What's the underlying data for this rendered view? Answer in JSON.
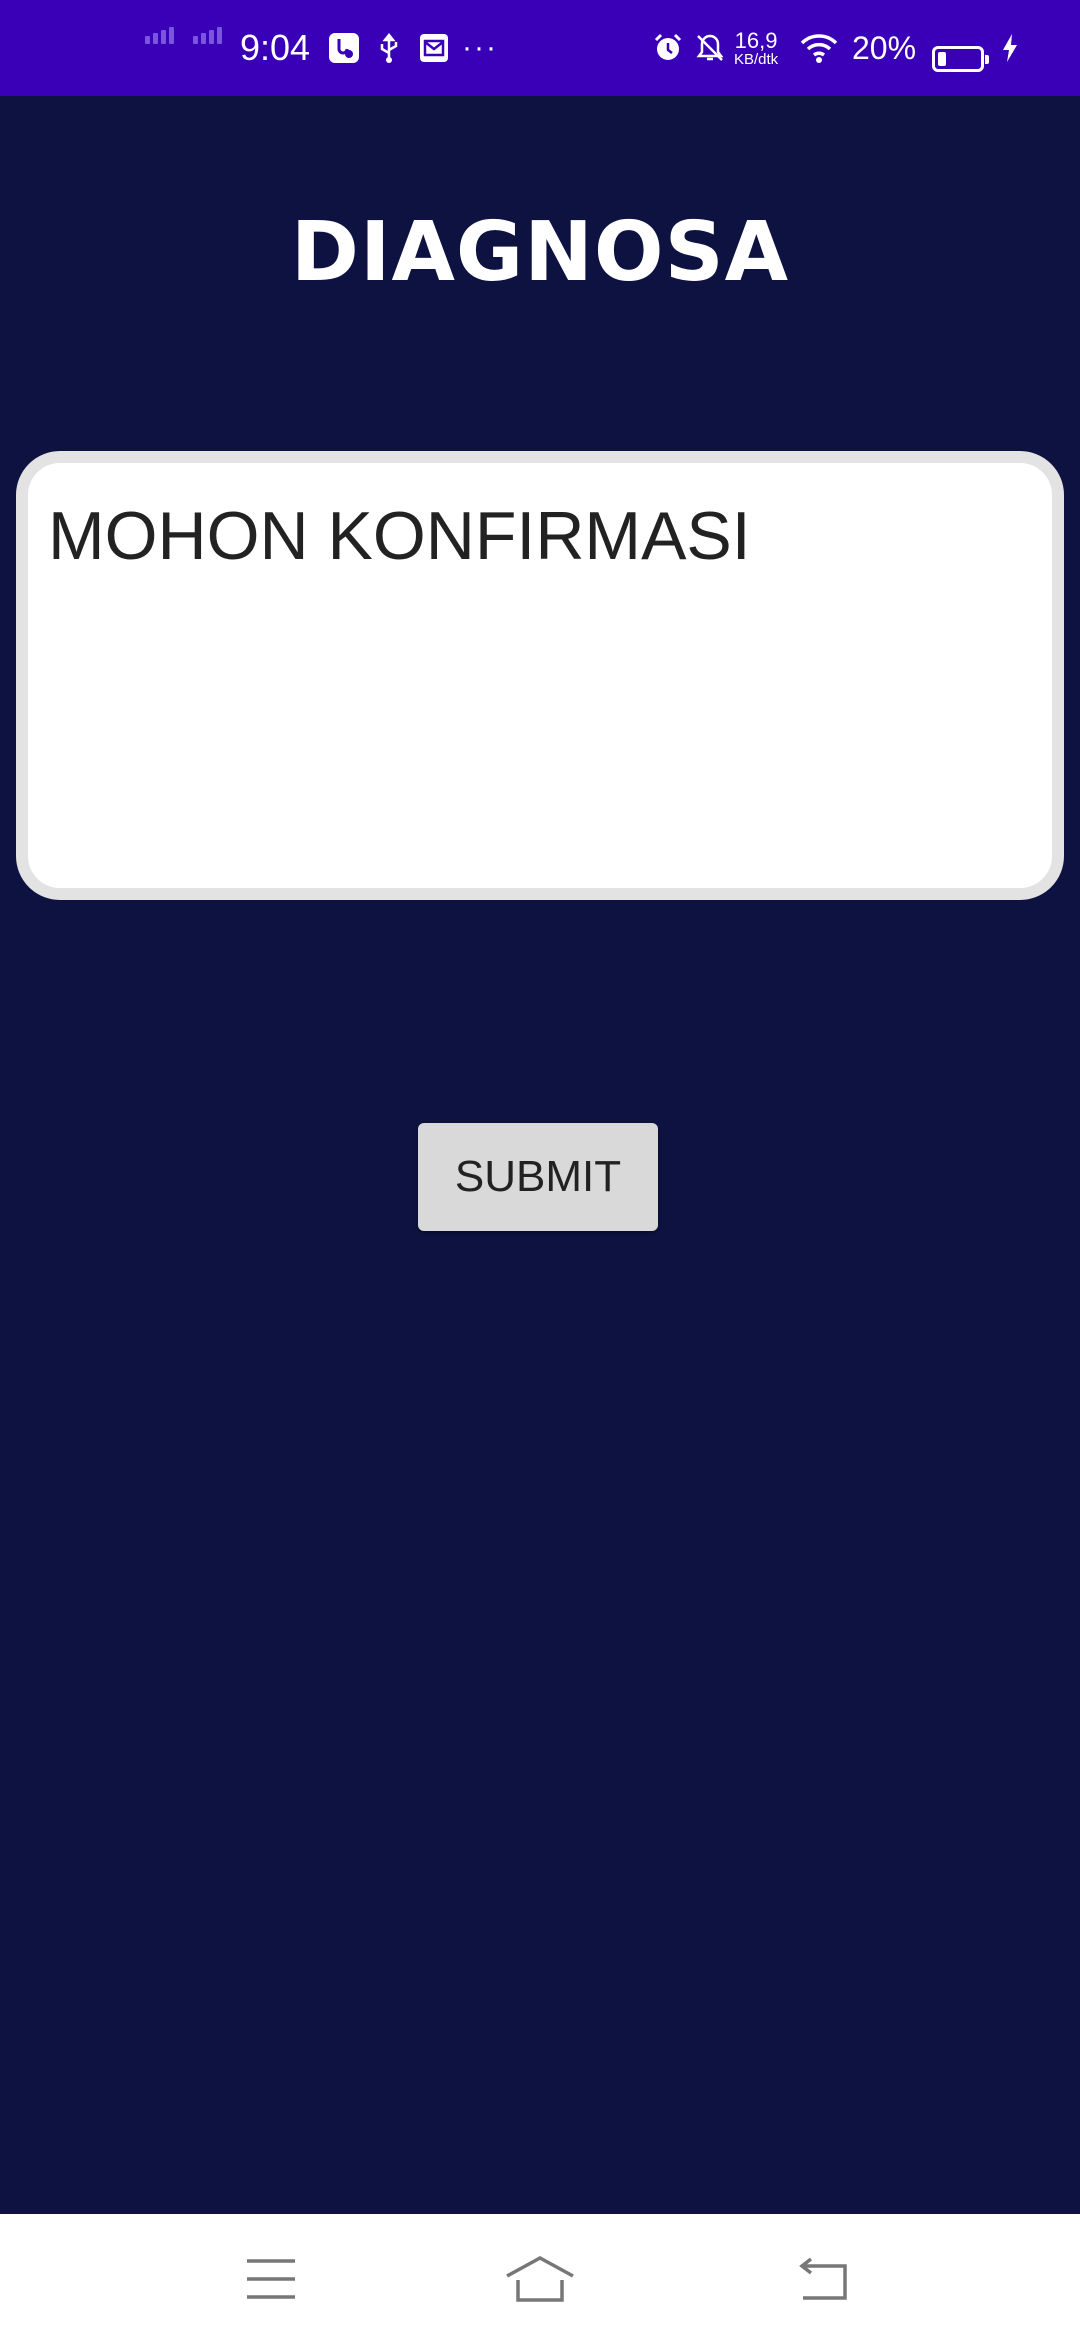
{
  "status_bar": {
    "time": "9:04",
    "net_speed_value": "16,9",
    "net_speed_unit": "KB/dtk",
    "battery_percent": "20%",
    "more_indicator": "···",
    "battery_level": 0.2,
    "icons": [
      "signal-icon",
      "usb-debug-icon",
      "usb-icon",
      "mail-icon",
      "alarm-icon",
      "notifications-off-icon",
      "wifi-icon",
      "battery-icon",
      "charging-icon"
    ]
  },
  "page": {
    "title": "DIAGNOSA"
  },
  "form": {
    "text_value": "MOHON KONFIRMASI",
    "submit_label": "SUBMIT"
  },
  "nav_bar": {
    "icons": [
      "menu-icon",
      "home-icon",
      "back-icon"
    ]
  },
  "colors": {
    "status_bar": "#3a00b8",
    "background": "#0d1241",
    "field_border": "#e3e3e3",
    "button_bg": "#d9d9d9"
  }
}
